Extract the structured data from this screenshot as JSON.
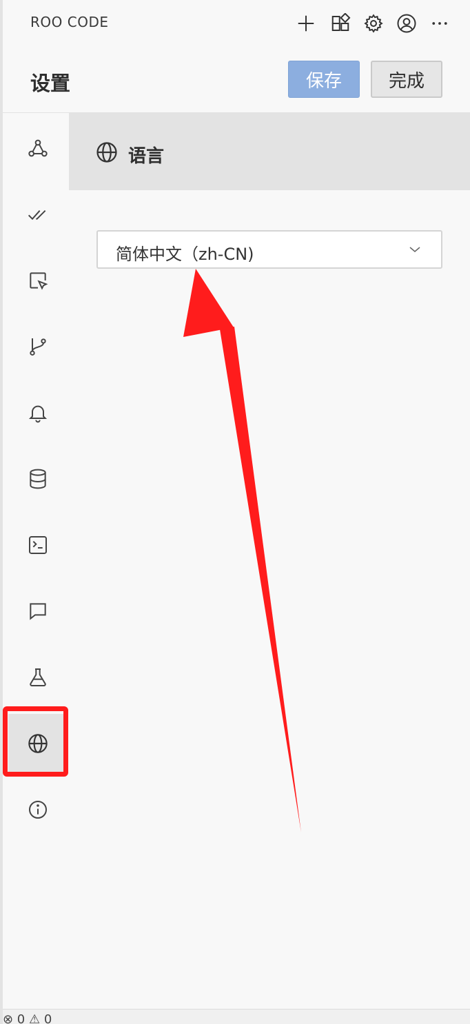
{
  "app": {
    "title": "ROO CODE",
    "toolbar_icons": [
      "plus-icon",
      "marketplace-icon",
      "gear-icon",
      "account-icon",
      "more-icon"
    ]
  },
  "header": {
    "title": "设置",
    "save_label": "保存",
    "done_label": "完成"
  },
  "sidebar": {
    "items": [
      {
        "icon": "webhook-icon"
      },
      {
        "icon": "check-all-icon"
      },
      {
        "icon": "cursor-icon"
      },
      {
        "icon": "git-branch-icon"
      },
      {
        "icon": "bell-icon"
      },
      {
        "icon": "database-icon"
      },
      {
        "icon": "terminal-icon"
      },
      {
        "icon": "chat-icon"
      },
      {
        "icon": "flask-icon"
      },
      {
        "icon": "globe-icon",
        "active": true
      },
      {
        "icon": "info-icon"
      }
    ]
  },
  "section": {
    "title": "语言",
    "icon": "globe-icon"
  },
  "language_select": {
    "value": "简体中文（zh-CN)"
  },
  "status": {
    "text": "⊗ 0 ⚠ 0"
  },
  "colors": {
    "accent_save": "#8caedf",
    "annotation_red": "#ff1c1c",
    "active_bg": "#e3e3e3"
  }
}
